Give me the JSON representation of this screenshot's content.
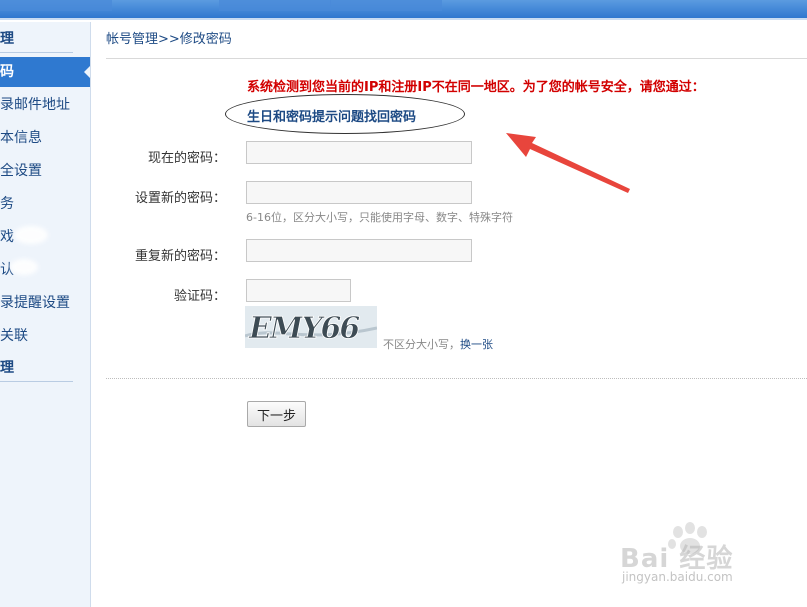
{
  "sidebar": {
    "head_top": "理",
    "items": [
      {
        "label": "码",
        "active": true
      },
      {
        "label": "录邮件地址"
      },
      {
        "label": "本信息"
      },
      {
        "label": "全设置"
      },
      {
        "label": "务"
      },
      {
        "label": "戏"
      },
      {
        "label": "认"
      },
      {
        "label": "录提醒设置"
      },
      {
        "label": "关联"
      }
    ],
    "head_bottom": "理"
  },
  "breadcrumb": "帐号管理>>修改密码",
  "alert_text": "系统检测到您当前的IP和注册IP不在同一地区。为了您的帐号安全，请您通过：",
  "recover_link": "生日和密码提示问题找回密码",
  "form": {
    "current_password_label": "现在的密码：",
    "new_password_label": "设置新的密码：",
    "new_password_hint": "6-16位，区分大小写，只能使用字母、数字、特殊字符",
    "repeat_password_label": "重复新的密码：",
    "captcha_label": "验证码：",
    "captcha_text": "EMY66",
    "captcha_note": "不区分大小写，",
    "captcha_change": "换一张",
    "next_button": "下一步"
  },
  "watermark": {
    "brand": "Bai 经验",
    "url": "jingyan.baidu.com"
  },
  "colors": {
    "accent": "#2f79d0",
    "alert": "#d20000",
    "link": "#1d4a84",
    "arrow": "#e8453c"
  }
}
